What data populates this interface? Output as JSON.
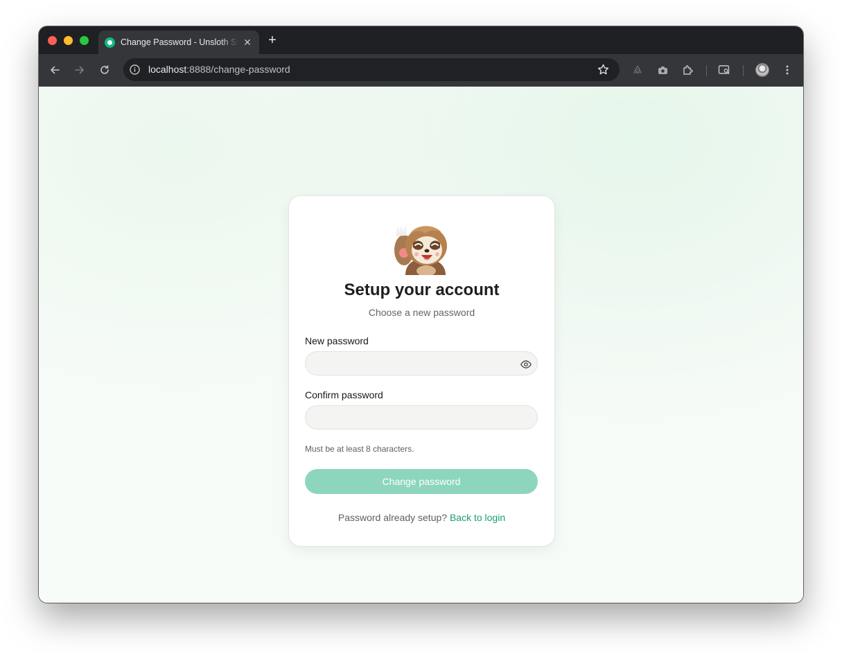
{
  "browser": {
    "tab_title": "Change Password - Unsloth Studio",
    "tab_close": "✕",
    "new_tab": "+",
    "url_host": "localhost",
    "url_path": ":8888/change-password",
    "icons": [
      "back-arrow-icon",
      "forward-arrow-icon",
      "reload-icon",
      "site-info-icon",
      "bookmark-star-icon",
      "recycle-extension-icon",
      "camera-extension-icon",
      "extensions-puzzle-icon",
      "reading-mode-icon",
      "profile-avatar",
      "more-menu-icon"
    ]
  },
  "page": {
    "title": "Setup your account",
    "subtitle": "Choose a new password",
    "new_password": {
      "label": "New password",
      "value": "",
      "placeholder": ""
    },
    "confirm_password": {
      "label": "Confirm password",
      "value": "",
      "placeholder": ""
    },
    "hint": "Must be at least 8 characters.",
    "submit_label": "Change password",
    "footer_text": "Password already setup?",
    "footer_link": "Back to login"
  },
  "colors": {
    "accent": "#1a9e73",
    "button_disabled": "#8dd6bd",
    "chrome_dark": "#35363a"
  }
}
